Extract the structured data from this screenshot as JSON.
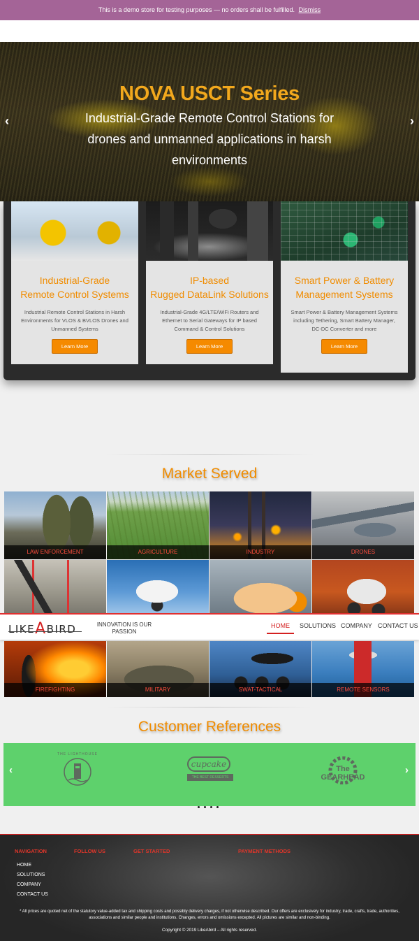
{
  "notice": {
    "text": "This is a demo store for testing purposes — no orders shall be fulfilled.",
    "dismiss": "Dismiss"
  },
  "hero": {
    "title": "NOVA USCT Series",
    "subtitle": "Industrial-Grade Remote Control Stations for drones and unmanned applications in harsh environments",
    "prev_arrow": "‹",
    "next_arrow": "›"
  },
  "solutions": [
    {
      "title_line1": "Industrial-Grade",
      "title_line2": "Remote Control Systems",
      "desc": "Industrial Remote Control Stations in Harsh Environments for VLOS & BVLOS Drones and Unmanned Systems",
      "button": "Learn More"
    },
    {
      "title_line1": "IP-based",
      "title_line2": "Rugged DataLink Solutions",
      "desc": "Industrial-Grade 4G/LTE/WiFi Routers and Ethernet to Serial Gateways for IP based Command & Control Solutions",
      "button": "Learn More"
    },
    {
      "title_line1": "Smart Power & Battery",
      "title_line2": "Management Systems",
      "desc": "Smart Power & Battery Management Systems including Tethering, Smart Battery Manager, DC-DC Converter and more",
      "button": "Learn More"
    }
  ],
  "markets": {
    "title": "Market Served",
    "tiles": [
      "LAW ENFORCEMENT",
      "AGRICULTURE",
      "INDUSTRY",
      "DRONES",
      "FIREFIGHTING",
      "MILITARY",
      "SWAT-TACTICAL",
      "REMOTE SENSORS"
    ]
  },
  "header": {
    "logo_left": "LIKE",
    "logo_a": "A",
    "logo_right": "BIRD",
    "tagline": "INNOVATION IS OUR PASSION",
    "nav": [
      "HOME",
      "SOLUTIONS",
      "COMPANY",
      "CONTACT US"
    ],
    "active": "HOME"
  },
  "references": {
    "title": "Customer References",
    "logos": [
      "THE LIGHTHOUSE",
      "cupcake",
      "The GEARHEAD"
    ],
    "cupcake_sub": "THE BEST DESSERTS",
    "prev_arrow": "‹",
    "next_arrow": "›"
  },
  "footer": {
    "headings": [
      "NAVIGATION",
      "FOLLOW US",
      "GET STARTED",
      "PAYMENT METHODS"
    ],
    "links": [
      "HOME",
      "SOLUTIONS",
      "COMPANY",
      "CONTACT US"
    ],
    "disclaimer": "* All prices are quoted net of the statutory value-added tax and shipping costs and possibly delivery charges, if not otherwise described. Our offers are exclusively for industry, trade, crafts, trade, authorities, associations and similar people and institutions. Changes, errors and omissions excepted. All pictures are similar and non-binding.",
    "copyright": "Copyright © 2019 LikeAbird – All rights reserved."
  },
  "colors": {
    "accent": "#f08c00",
    "brand_red": "#d42020",
    "notice_bg": "#a46497",
    "references_bg": "#5ed16c"
  }
}
